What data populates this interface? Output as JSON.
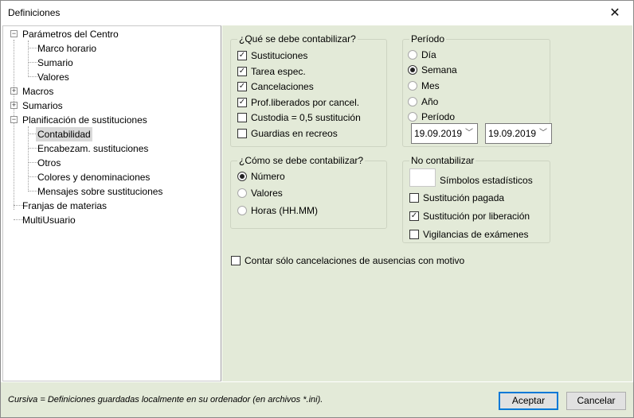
{
  "window": {
    "title": "Definiciones",
    "close_symbol": "✕"
  },
  "tree": {
    "items": [
      {
        "label": "Parámetros del Centro",
        "expander": "−"
      },
      {
        "label": "Marco horario"
      },
      {
        "label": "Sumario"
      },
      {
        "label": "Valores"
      },
      {
        "label": "Macros",
        "expander": "+"
      },
      {
        "label": "Sumarios",
        "expander": "+"
      },
      {
        "label": "Planificación de sustituciones",
        "expander": "−"
      },
      {
        "label": "Contabilidad",
        "selected": true
      },
      {
        "label": "Encabezam. sustituciones"
      },
      {
        "label": "Otros"
      },
      {
        "label": "Colores y denominaciones"
      },
      {
        "label": "Mensajes sobre sustituciones"
      },
      {
        "label": "Franjas de materias"
      },
      {
        "label": "MultiUsuario"
      }
    ]
  },
  "que_group": {
    "title": "¿Qué se debe contabilizar?",
    "items": [
      {
        "label": "Sustituciones",
        "checked": "✓"
      },
      {
        "label": "Tarea espec.",
        "checked": "✓"
      },
      {
        "label": "Cancelaciones",
        "checked": "✓"
      },
      {
        "label": "Prof.liberados por cancel.",
        "checked": "✓"
      },
      {
        "label": "Custodia = 0,5 sustitución",
        "checked": ""
      },
      {
        "label": "Guardias en recreos",
        "checked": ""
      }
    ]
  },
  "periodo_group": {
    "title": "Período",
    "items": [
      {
        "label": "Día",
        "selected": false
      },
      {
        "label": "Semana",
        "selected": true
      },
      {
        "label": "Mes",
        "selected": false
      },
      {
        "label": "Año",
        "selected": false
      },
      {
        "label": "Período",
        "selected": false
      }
    ],
    "date_from": "19.09.2019",
    "date_to": "19.09.2019",
    "chevron": "﹀"
  },
  "como_group": {
    "title": "¿Cómo se debe contabilizar?",
    "items": [
      {
        "label": "Número",
        "selected": true
      },
      {
        "label": "Valores",
        "selected": false
      },
      {
        "label": "Horas (HH.MM)",
        "selected": false
      }
    ]
  },
  "no_group": {
    "title": "No contabilizar",
    "symbols_label": "Símbolos estadísticos",
    "items": [
      {
        "label": "Sustitución pagada",
        "checked": ""
      },
      {
        "label": "Sustitución por liberación",
        "checked": "✓"
      },
      {
        "label": "Vigilancias de exámenes",
        "checked": ""
      }
    ]
  },
  "contar_option": {
    "label": "Contar sólo cancelaciones de ausencias con motivo",
    "checked": ""
  },
  "footer": {
    "note": "Cursiva = Definiciones guardadas localmente en su ordenador (en archivos *.ini).",
    "ok_label": "Aceptar",
    "cancel_label": "Cancelar"
  }
}
